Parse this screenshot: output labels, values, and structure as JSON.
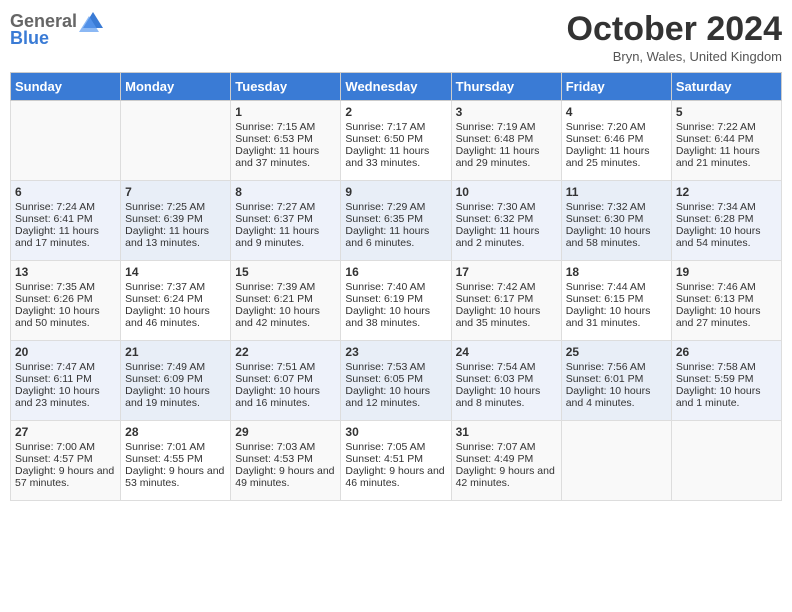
{
  "header": {
    "logo_general": "General",
    "logo_blue": "Blue",
    "month": "October 2024",
    "location": "Bryn, Wales, United Kingdom"
  },
  "days_of_week": [
    "Sunday",
    "Monday",
    "Tuesday",
    "Wednesday",
    "Thursday",
    "Friday",
    "Saturday"
  ],
  "weeks": [
    [
      {
        "day": "",
        "sunrise": "",
        "sunset": "",
        "daylight": ""
      },
      {
        "day": "",
        "sunrise": "",
        "sunset": "",
        "daylight": ""
      },
      {
        "day": "1",
        "sunrise": "Sunrise: 7:15 AM",
        "sunset": "Sunset: 6:53 PM",
        "daylight": "Daylight: 11 hours and 37 minutes."
      },
      {
        "day": "2",
        "sunrise": "Sunrise: 7:17 AM",
        "sunset": "Sunset: 6:50 PM",
        "daylight": "Daylight: 11 hours and 33 minutes."
      },
      {
        "day": "3",
        "sunrise": "Sunrise: 7:19 AM",
        "sunset": "Sunset: 6:48 PM",
        "daylight": "Daylight: 11 hours and 29 minutes."
      },
      {
        "day": "4",
        "sunrise": "Sunrise: 7:20 AM",
        "sunset": "Sunset: 6:46 PM",
        "daylight": "Daylight: 11 hours and 25 minutes."
      },
      {
        "day": "5",
        "sunrise": "Sunrise: 7:22 AM",
        "sunset": "Sunset: 6:44 PM",
        "daylight": "Daylight: 11 hours and 21 minutes."
      }
    ],
    [
      {
        "day": "6",
        "sunrise": "Sunrise: 7:24 AM",
        "sunset": "Sunset: 6:41 PM",
        "daylight": "Daylight: 11 hours and 17 minutes."
      },
      {
        "day": "7",
        "sunrise": "Sunrise: 7:25 AM",
        "sunset": "Sunset: 6:39 PM",
        "daylight": "Daylight: 11 hours and 13 minutes."
      },
      {
        "day": "8",
        "sunrise": "Sunrise: 7:27 AM",
        "sunset": "Sunset: 6:37 PM",
        "daylight": "Daylight: 11 hours and 9 minutes."
      },
      {
        "day": "9",
        "sunrise": "Sunrise: 7:29 AM",
        "sunset": "Sunset: 6:35 PM",
        "daylight": "Daylight: 11 hours and 6 minutes."
      },
      {
        "day": "10",
        "sunrise": "Sunrise: 7:30 AM",
        "sunset": "Sunset: 6:32 PM",
        "daylight": "Daylight: 11 hours and 2 minutes."
      },
      {
        "day": "11",
        "sunrise": "Sunrise: 7:32 AM",
        "sunset": "Sunset: 6:30 PM",
        "daylight": "Daylight: 10 hours and 58 minutes."
      },
      {
        "day": "12",
        "sunrise": "Sunrise: 7:34 AM",
        "sunset": "Sunset: 6:28 PM",
        "daylight": "Daylight: 10 hours and 54 minutes."
      }
    ],
    [
      {
        "day": "13",
        "sunrise": "Sunrise: 7:35 AM",
        "sunset": "Sunset: 6:26 PM",
        "daylight": "Daylight: 10 hours and 50 minutes."
      },
      {
        "day": "14",
        "sunrise": "Sunrise: 7:37 AM",
        "sunset": "Sunset: 6:24 PM",
        "daylight": "Daylight: 10 hours and 46 minutes."
      },
      {
        "day": "15",
        "sunrise": "Sunrise: 7:39 AM",
        "sunset": "Sunset: 6:21 PM",
        "daylight": "Daylight: 10 hours and 42 minutes."
      },
      {
        "day": "16",
        "sunrise": "Sunrise: 7:40 AM",
        "sunset": "Sunset: 6:19 PM",
        "daylight": "Daylight: 10 hours and 38 minutes."
      },
      {
        "day": "17",
        "sunrise": "Sunrise: 7:42 AM",
        "sunset": "Sunset: 6:17 PM",
        "daylight": "Daylight: 10 hours and 35 minutes."
      },
      {
        "day": "18",
        "sunrise": "Sunrise: 7:44 AM",
        "sunset": "Sunset: 6:15 PM",
        "daylight": "Daylight: 10 hours and 31 minutes."
      },
      {
        "day": "19",
        "sunrise": "Sunrise: 7:46 AM",
        "sunset": "Sunset: 6:13 PM",
        "daylight": "Daylight: 10 hours and 27 minutes."
      }
    ],
    [
      {
        "day": "20",
        "sunrise": "Sunrise: 7:47 AM",
        "sunset": "Sunset: 6:11 PM",
        "daylight": "Daylight: 10 hours and 23 minutes."
      },
      {
        "day": "21",
        "sunrise": "Sunrise: 7:49 AM",
        "sunset": "Sunset: 6:09 PM",
        "daylight": "Daylight: 10 hours and 19 minutes."
      },
      {
        "day": "22",
        "sunrise": "Sunrise: 7:51 AM",
        "sunset": "Sunset: 6:07 PM",
        "daylight": "Daylight: 10 hours and 16 minutes."
      },
      {
        "day": "23",
        "sunrise": "Sunrise: 7:53 AM",
        "sunset": "Sunset: 6:05 PM",
        "daylight": "Daylight: 10 hours and 12 minutes."
      },
      {
        "day": "24",
        "sunrise": "Sunrise: 7:54 AM",
        "sunset": "Sunset: 6:03 PM",
        "daylight": "Daylight: 10 hours and 8 minutes."
      },
      {
        "day": "25",
        "sunrise": "Sunrise: 7:56 AM",
        "sunset": "Sunset: 6:01 PM",
        "daylight": "Daylight: 10 hours and 4 minutes."
      },
      {
        "day": "26",
        "sunrise": "Sunrise: 7:58 AM",
        "sunset": "Sunset: 5:59 PM",
        "daylight": "Daylight: 10 hours and 1 minute."
      }
    ],
    [
      {
        "day": "27",
        "sunrise": "Sunrise: 7:00 AM",
        "sunset": "Sunset: 4:57 PM",
        "daylight": "Daylight: 9 hours and 57 minutes."
      },
      {
        "day": "28",
        "sunrise": "Sunrise: 7:01 AM",
        "sunset": "Sunset: 4:55 PM",
        "daylight": "Daylight: 9 hours and 53 minutes."
      },
      {
        "day": "29",
        "sunrise": "Sunrise: 7:03 AM",
        "sunset": "Sunset: 4:53 PM",
        "daylight": "Daylight: 9 hours and 49 minutes."
      },
      {
        "day": "30",
        "sunrise": "Sunrise: 7:05 AM",
        "sunset": "Sunset: 4:51 PM",
        "daylight": "Daylight: 9 hours and 46 minutes."
      },
      {
        "day": "31",
        "sunrise": "Sunrise: 7:07 AM",
        "sunset": "Sunset: 4:49 PM",
        "daylight": "Daylight: 9 hours and 42 minutes."
      },
      {
        "day": "",
        "sunrise": "",
        "sunset": "",
        "daylight": ""
      },
      {
        "day": "",
        "sunrise": "",
        "sunset": "",
        "daylight": ""
      }
    ]
  ]
}
